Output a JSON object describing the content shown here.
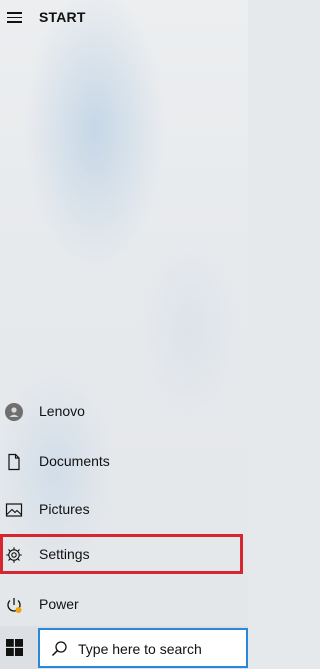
{
  "header": {
    "title": "START"
  },
  "menu": {
    "lenovo": "Lenovo",
    "documents": "Documents",
    "pictures": "Pictures",
    "settings": "Settings",
    "power": "Power"
  },
  "icons": {
    "hamburger": "hamburger-icon",
    "user": "user-avatar-icon",
    "documents": "document-icon",
    "pictures": "picture-icon",
    "settings": "gear-icon",
    "power": "power-icon",
    "windows": "windows-logo-icon",
    "search": "search-icon"
  },
  "colors": {
    "highlight": "#d7262f",
    "search_border": "#2b88d8",
    "power_badge": "#f0a30a"
  },
  "taskbar": {
    "search_placeholder": "Type here to search"
  }
}
